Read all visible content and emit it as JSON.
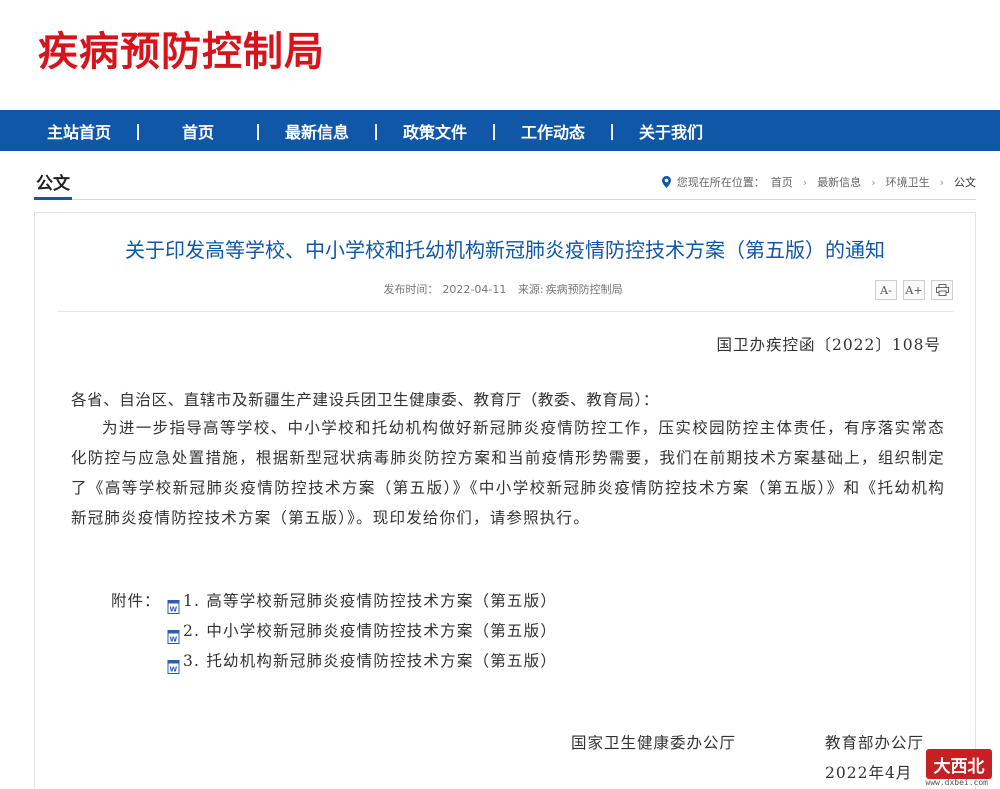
{
  "header": {
    "site_title": "疾病预防控制局"
  },
  "nav": {
    "items": [
      {
        "label": "主站首页"
      },
      {
        "label": "首页"
      },
      {
        "label": "最新信息"
      },
      {
        "label": "政策文件"
      },
      {
        "label": "工作动态"
      },
      {
        "label": "关于我们"
      }
    ],
    "separator": "|"
  },
  "section": {
    "title": "公文"
  },
  "breadcrumb": {
    "prefix": "您现在所在位置：",
    "items": [
      "首页",
      "最新信息",
      "环境卫生",
      "公文"
    ],
    "separator": "›"
  },
  "article": {
    "title": "关于印发高等学校、中小学校和托幼机构新冠肺炎疫情防控技术方案（第五版）的通知",
    "publish_label": "发布时间：",
    "publish_date": "2022-04-11",
    "source_label": "来源:",
    "source": "疾病预防控制局",
    "tools": {
      "font_small": "A-",
      "font_large": "A+",
      "print": "print-icon"
    },
    "doc_number": "国卫办疾控函〔2022〕108号",
    "salutation": "各省、自治区、直辖市及新疆生产建设兵团卫生健康委、教育厅（教委、教育局）：",
    "body": "为进一步指导高等学校、中小学校和托幼机构做好新冠肺炎疫情防控工作，压实校园防控主体责任，有序落实常态化防控与应急处置措施，根据新型冠状病毒肺炎防控方案和当前疫情形势需要，我们在前期技术方案基础上，组织制定了《高等学校新冠肺炎疫情防控技术方案（第五版）》《中小学校新冠肺炎疫情防控技术方案（第五版）》和《托幼机构新冠肺炎疫情防控技术方案（第五版）》。现印发给你们，请参照执行。",
    "attachments_label": "附件：",
    "attachments": [
      "1. 高等学校新冠肺炎疫情防控技术方案（第五版）",
      "2. 中小学校新冠肺炎疫情防控技术方案（第五版）",
      "3. 托幼机构新冠肺炎疫情防控技术方案（第五版）"
    ],
    "signatory_1": "国家卫生健康委办公厅",
    "signatory_2": "教育部办公厅",
    "date": "2022年4月"
  },
  "watermark": {
    "text": "大西北",
    "url": "www.dxbei.com"
  },
  "colors": {
    "brand_red": "#d7141b",
    "nav_blue": "#1057a7",
    "title_blue": "#1057a7"
  }
}
